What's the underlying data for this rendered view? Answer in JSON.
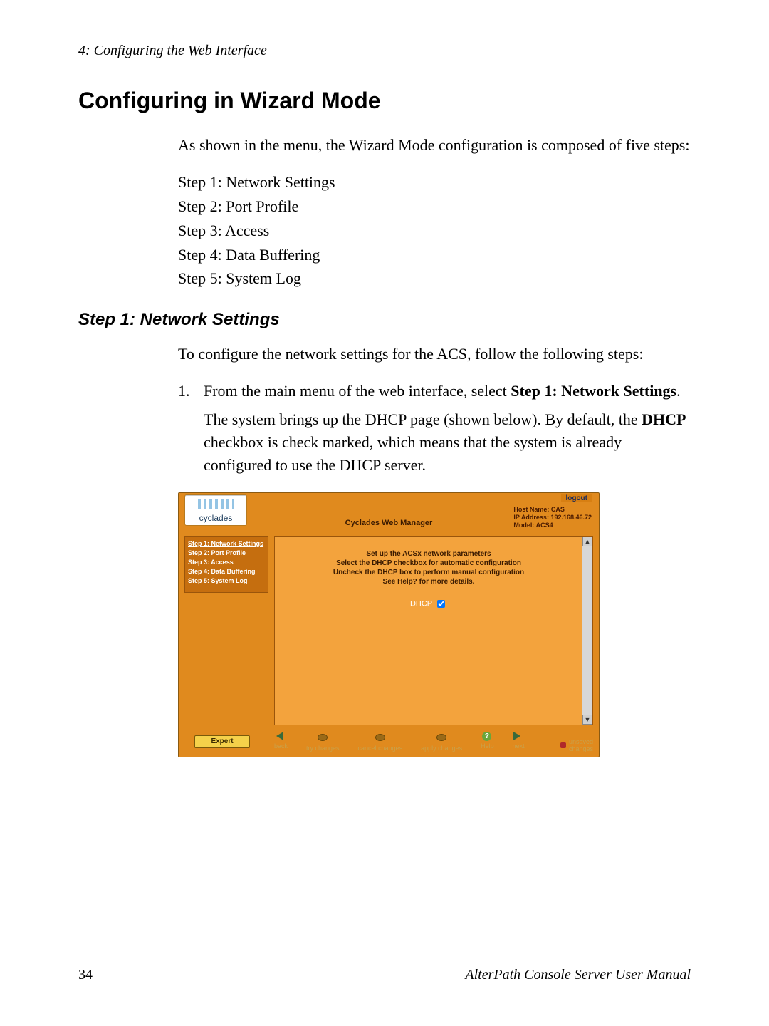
{
  "running_head": "4: Configuring the Web Interface",
  "h1": "Configuring in Wizard Mode",
  "intro": "As shown in the menu, the Wizard Mode configuration is composed of five steps:",
  "steps": [
    "Step 1: Network Settings",
    "Step 2: Port Profile",
    "Step 3: Access",
    "Step 4: Data Buffering",
    "Step 5: System Log"
  ],
  "h2": "Step 1: Network Settings",
  "h2_intro": "To configure the network settings for the ACS, follow the following steps:",
  "list1_num": "1.",
  "list1_a": "From the main menu of the web interface, select ",
  "list1_b": "Step 1: Network Settings",
  "list1_c": ".",
  "list1_p2a": "The system brings up the DHCP page (shown below). By default, the ",
  "list1_p2b": "DHCP",
  "list1_p2c": " checkbox is check marked, which means that the system is already configured to use the DHCP server.",
  "figure": {
    "logo": "cyclades",
    "logout": "logout",
    "host_line1": "Host Name: CAS",
    "host_line2": "IP Address: 192.168.46.72",
    "host_line3": "Model: ACS4",
    "title": "Cyclades Web Manager",
    "side": [
      "Step 1: Network Settings",
      "Step 2: Port Profile",
      "Step 3: Access",
      "Step 4: Data Buffering",
      "Step 5: System Log"
    ],
    "msg1": "Set up the ACSx network parameters",
    "msg2": "Select the DHCP checkbox for automatic configuration",
    "msg3": "Uncheck the DHCP box to perform manual configuration",
    "msg4": "See Help? for more details.",
    "dhcp_label": "DHCP",
    "dhcp_checked": true,
    "expert": "Expert",
    "foot": {
      "back": "back",
      "try": "try changes",
      "cancel": "cancel changes",
      "apply": "apply changes",
      "help": "Help",
      "next": "next",
      "unsaved1": "unsaved",
      "unsaved2": "changes"
    }
  },
  "page_number": "34",
  "manual": "AlterPath Console Server User Manual"
}
